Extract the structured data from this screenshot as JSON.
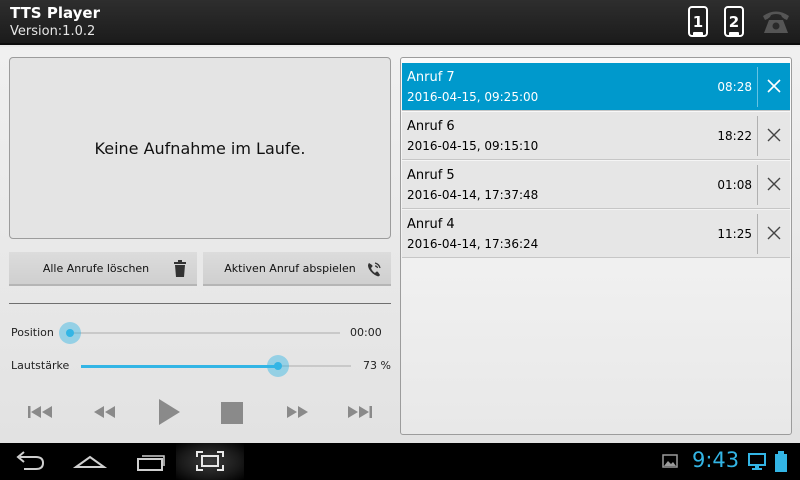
{
  "app": {
    "title": "TTS Player",
    "version": "Version:1.0.2"
  },
  "actionbar": {
    "icons": [
      {
        "name": "phone-1-icon",
        "label": "1"
      },
      {
        "name": "phone-2-icon",
        "label": "2"
      },
      {
        "name": "telephone-icon"
      }
    ]
  },
  "status": {
    "message": "Keine Aufnahme im Laufe."
  },
  "buttons": {
    "delete_all": "Alle Anrufe löschen",
    "play_active": "Aktiven Anruf abspielen"
  },
  "player": {
    "position_label": "Position",
    "position_time": "00:00",
    "position_fraction": 0,
    "volume_label": "Lautstärke",
    "volume_value": "73 %",
    "volume_fraction": 0.73,
    "controls": [
      "skip-previous-icon",
      "rewind-icon",
      "play-icon",
      "stop-icon",
      "fast-forward-icon",
      "skip-next-icon"
    ]
  },
  "calls": [
    {
      "name": "Anruf 7",
      "date": "2016-04-15, 09:25:00",
      "duration": "08:28",
      "active": true
    },
    {
      "name": "Anruf 6",
      "date": "2016-04-15, 09:15:10",
      "duration": "18:22",
      "active": false
    },
    {
      "name": "Anruf 5",
      "date": "2016-04-14, 17:37:48",
      "duration": "01:08",
      "active": false
    },
    {
      "name": "Anruf 4",
      "date": "2016-04-14, 17:36:24",
      "duration": "11:25",
      "active": false
    }
  ],
  "system": {
    "clock": "9:43"
  },
  "colors": {
    "accent": "#33b5e5",
    "selected_row": "#0099cc"
  }
}
